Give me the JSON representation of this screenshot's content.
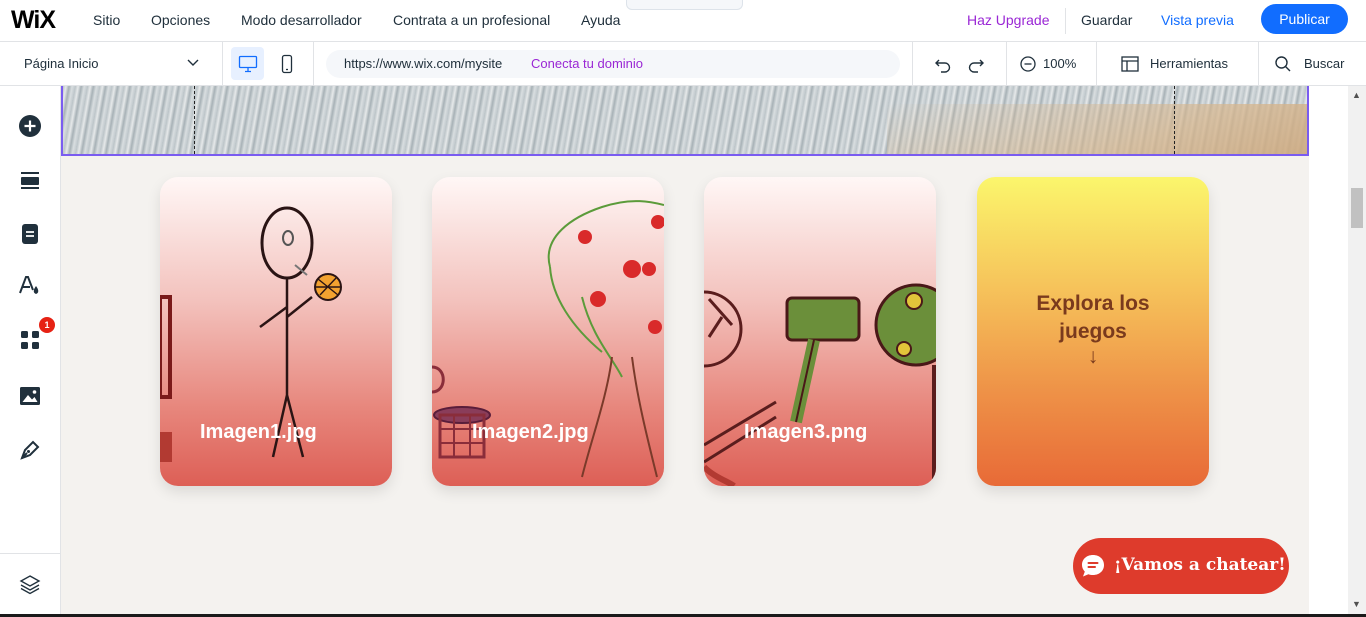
{
  "app": {
    "logo": "WiX"
  },
  "topbar": {
    "menu": [
      "Sitio",
      "Opciones",
      "Modo desarrollador",
      "Contrata a un profesional",
      "Ayuda"
    ],
    "collapse_glyph": "⌃",
    "upgrade": "Haz Upgrade",
    "save": "Guardar",
    "preview": "Vista previa",
    "publish": "Publicar"
  },
  "toolbar": {
    "page_selector": "Página Inicio",
    "url": "https://www.wix.com/mysite",
    "connect_domain": "Conecta tu dominio",
    "zoom": "100%",
    "tools": "Herramientas",
    "search": "Buscar"
  },
  "sidebar": {
    "items": [
      {
        "icon": "add-icon"
      },
      {
        "icon": "sections-icon"
      },
      {
        "icon": "pages-icon"
      },
      {
        "icon": "theme-icon"
      },
      {
        "icon": "apps-icon"
      },
      {
        "icon": "media-icon"
      },
      {
        "icon": "pen-icon"
      }
    ],
    "apps_badge": "1",
    "layers_icon": "layers-icon"
  },
  "canvas": {
    "cards": [
      {
        "label": "Imagen1.jpg"
      },
      {
        "label": "Imagen2.jpg"
      },
      {
        "label": "Imagen3.png"
      }
    ],
    "cta": {
      "line1": "Explora los",
      "line2": "juegos",
      "arrow": "↓"
    },
    "chat": "¡Vamos a chatear!"
  },
  "colors": {
    "accent": "#116dff",
    "upgrade": "#9a27d5",
    "selection": "#7a5cf0",
    "chat": "#de3b2c"
  }
}
